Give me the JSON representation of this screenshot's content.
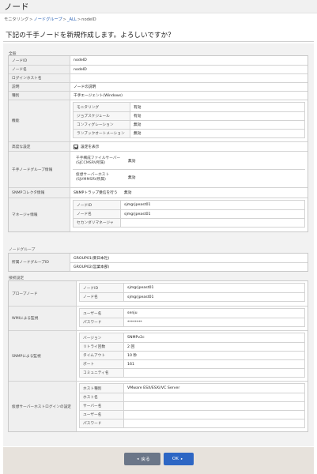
{
  "page": {
    "title": "ノード",
    "breadcrumb": [
      {
        "label": "モニタリング",
        "link": false
      },
      {
        "label": "ノードグループ",
        "link": true
      },
      {
        "label": "_ALL",
        "link": true
      },
      {
        "label": "nodeID",
        "link": false
      }
    ],
    "separator": ">",
    "confirm_message": "下記の千手ノードを新規作成します。よろしいですか？"
  },
  "sections": {
    "general": "全般",
    "node_group": "ノードグループ",
    "connection": "接続設定"
  },
  "general": {
    "node_id": {
      "label": "ノードID",
      "value": "nodeID"
    },
    "node_name": {
      "label": "ノード名",
      "value": "nodeID"
    },
    "login_host": {
      "label": "ログインホスト名",
      "value": ""
    },
    "description": {
      "label": "説明",
      "value": "ノードの説明"
    },
    "type": {
      "label": "種別",
      "value": "千手エージェント(Windows)"
    },
    "features": {
      "label": "機能",
      "items": [
        {
          "label": "モニタリング",
          "value": "有効"
        },
        {
          "label": "ジョブスケジュール",
          "value": "有効"
        },
        {
          "label": "コンフィグレーション",
          "value": "無効"
        },
        {
          "label": "ランブックオートメーション",
          "value": "無効"
        }
      ]
    },
    "advanced": {
      "label": "高度な設定",
      "checkbox_label": "設定を表示",
      "checked": true
    },
    "senju_group": {
      "label": "千手ノードグループ情報",
      "items": [
        {
          "label": "千手構成ファイルサーバー (SJCCMSRV所属)",
          "value": "無効"
        },
        {
          "label": "仮想サーバーホスト (SJVMMSRV所属)",
          "value": "無効"
        }
      ]
    },
    "snmp_collector": {
      "label": "SNMPコレクタ情報",
      "sublabel": "SNMPトラップ受信を行う",
      "value": "無効"
    },
    "manager": {
      "label": "マネージャ情報",
      "items": [
        {
          "label": "ノードID",
          "value": "sjmgrjpeast01"
        },
        {
          "label": "ノード名",
          "value": "sjmgrjpeast01"
        },
        {
          "label": "セカンダリマネージャ",
          "value": ""
        }
      ]
    }
  },
  "node_group": {
    "label": "所属ノードグループID",
    "values": [
      "GROUP01(東日本社)",
      "GROUP02(営業本部)"
    ]
  },
  "connection": {
    "proxy": {
      "label": "プロープノード",
      "items": [
        {
          "label": "ノードID",
          "value": "sjmgrjpeast01"
        },
        {
          "label": "ノード名",
          "value": "sjmgrjpeast01"
        }
      ]
    },
    "wmi": {
      "label": "WMIによる監視",
      "items": [
        {
          "label": "ユーザー名",
          "value": "senju"
        },
        {
          "label": "パスワード",
          "value": "********"
        }
      ]
    },
    "snmp": {
      "label": "SNMPによる監視",
      "items": [
        {
          "label": "バージョン",
          "value": "SNMPv2c"
        },
        {
          "label": "リトライ回数",
          "value": "2 回"
        },
        {
          "label": "タイムアウト",
          "value": "10 秒"
        },
        {
          "label": "ポート",
          "value": "161"
        },
        {
          "label": "コミュニティ名",
          "value": ""
        }
      ]
    },
    "vhost": {
      "label": "仮想サーバーホストログインの設定",
      "items": [
        {
          "label": "ホスト種別",
          "value": "VMware ESX/ESXi/VC Server"
        },
        {
          "label": "ホスト名",
          "value": ""
        },
        {
          "label": "サーバー名",
          "value": ""
        },
        {
          "label": "ユーザー名",
          "value": ""
        },
        {
          "label": "パスワード",
          "value": ""
        }
      ]
    }
  },
  "buttons": {
    "back": "戻る",
    "ok": "OK",
    "back_arrow": "◂",
    "ok_arrow": "▸"
  },
  "colors": {
    "ok": "#2d66c4",
    "back": "#6b7688",
    "link": "#2a62b5",
    "footer": "#e7e2dc"
  }
}
